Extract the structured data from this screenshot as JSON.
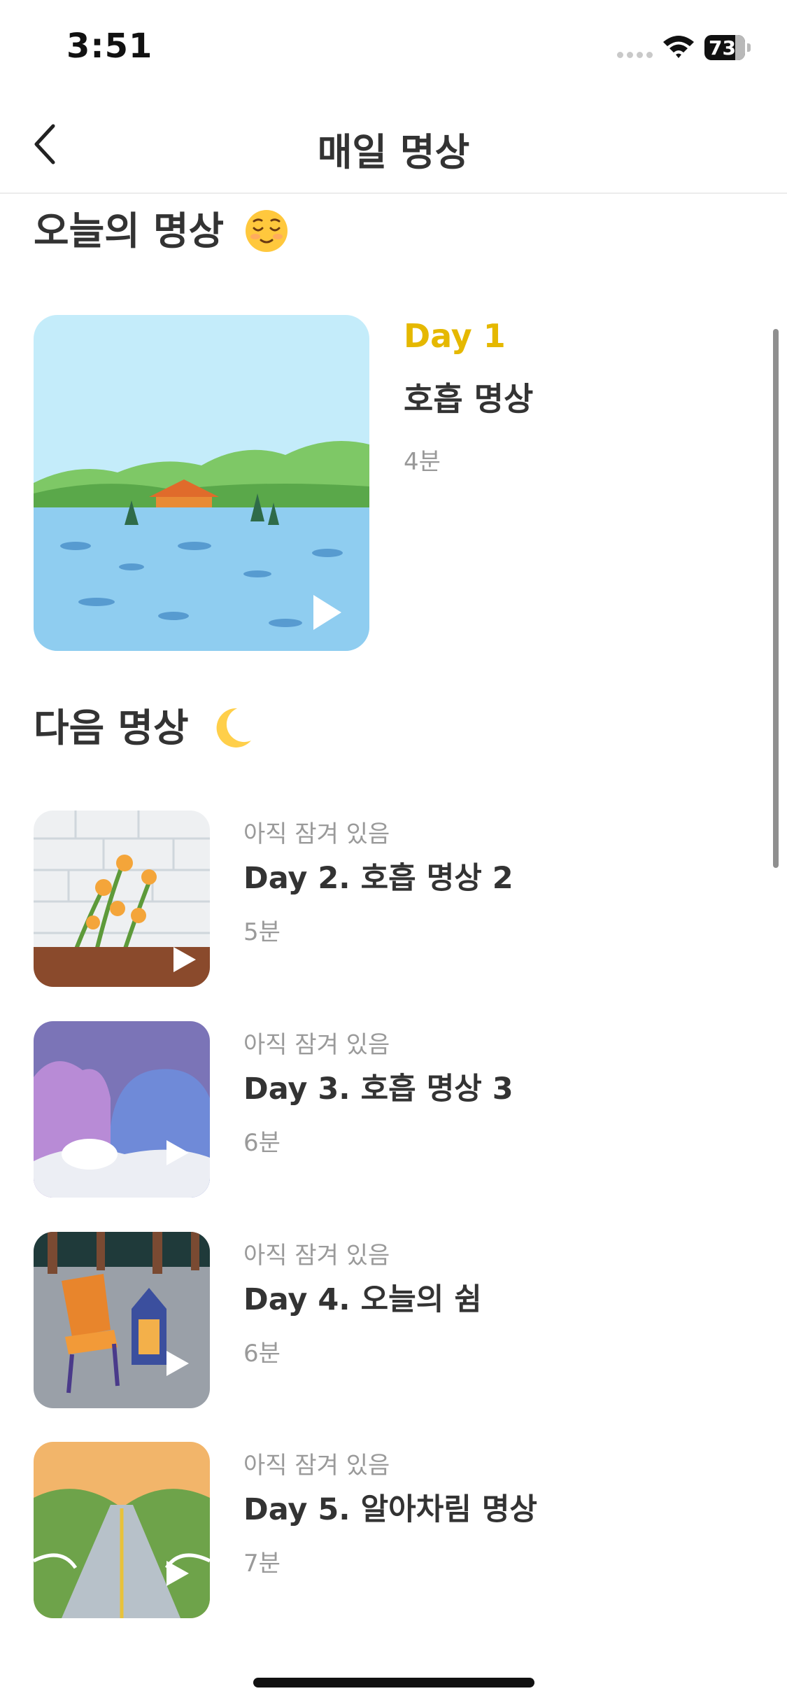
{
  "status_bar": {
    "time": "3:51",
    "battery": "73"
  },
  "nav": {
    "title": "매일 명상",
    "back_icon": "chevron-left-icon"
  },
  "today": {
    "heading": "오늘의 명상",
    "heading_emoji": "relieved-face-emoji",
    "day": "Day 1",
    "name": "호흡 명상",
    "duration": "4분"
  },
  "next": {
    "heading": "다음 명상",
    "heading_emoji": "crescent-moon-emoji",
    "items": [
      {
        "status": "아직 잠겨 있음",
        "title": "Day 2. 호흡 명상 2",
        "duration": "5분"
      },
      {
        "status": "아직 잠겨 있음",
        "title": "Day 3. 호흡 명상 3",
        "duration": "6분"
      },
      {
        "status": "아직 잠겨 있음",
        "title": "Day 4. 오늘의 쉼",
        "duration": "6분"
      },
      {
        "status": "아직 잠겨 있음",
        "title": "Day 5. 알아차림 명상",
        "duration": "7분"
      }
    ]
  },
  "colors": {
    "accent": "#e5b800",
    "text": "#333333",
    "muted": "#9a9a9a"
  }
}
